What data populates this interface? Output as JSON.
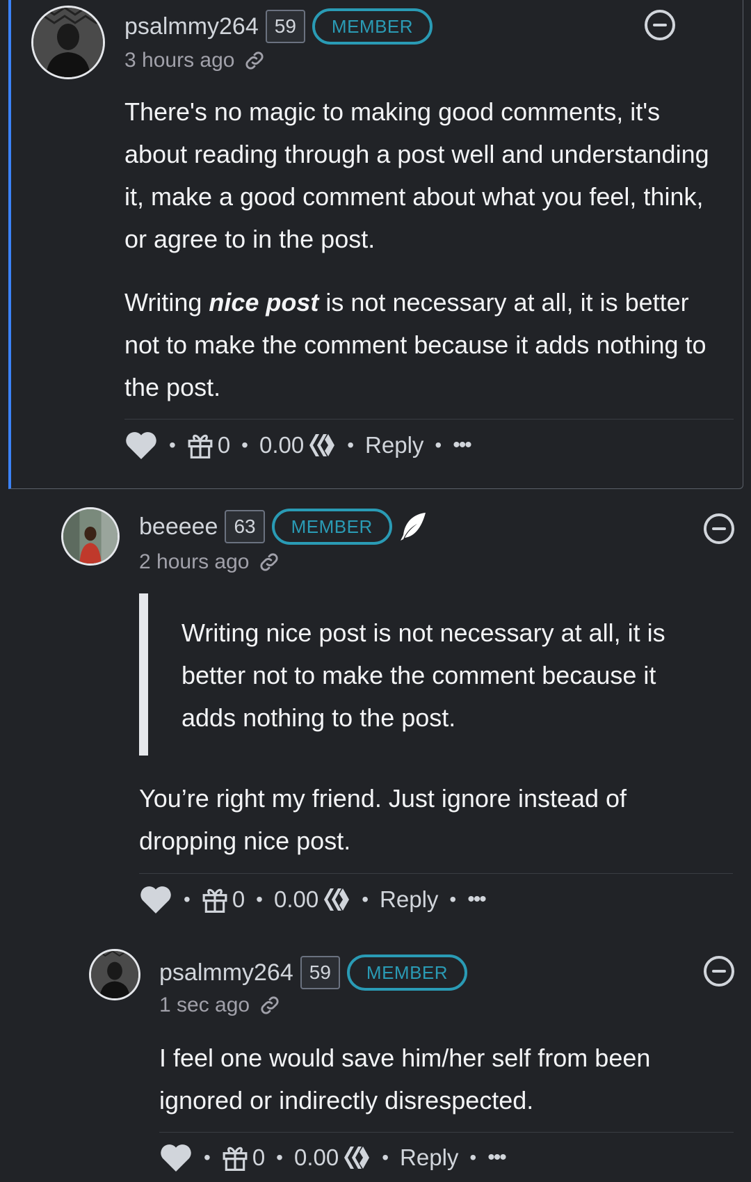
{
  "comments": [
    {
      "username": "psalmmy264",
      "reputation": "59",
      "badge": "MEMBER",
      "time": "3 hours ago",
      "paragraphs": [
        "There's no magic to making good comments, it's about reading through a post well and understanding it, make a good comment about what you feel, think, or agree to in the post."
      ],
      "para2_before": "Writing ",
      "para2_emph": "nice post",
      "para2_after": " is not necessary at all, it is better not to make the comment because it adds nothing to the post.",
      "gift_count": "0",
      "payout": "0.00",
      "reply_label": "Reply"
    },
    {
      "username": "beeeee",
      "reputation": "63",
      "badge": "MEMBER",
      "time": "2 hours ago",
      "quote": "Writing nice post is not necessary at all, it is better not to make the comment because it adds nothing to the post.",
      "text": "You’re right my friend. Just ignore instead of dropping nice post.",
      "gift_count": "0",
      "payout": "0.00",
      "reply_label": "Reply"
    },
    {
      "username": "psalmmy264",
      "reputation": "59",
      "badge": "MEMBER",
      "time": "1 sec ago",
      "text": "I feel one would save him/her self from been ignored or indirectly disrespected.",
      "gift_count": "0",
      "payout": "0.00",
      "reply_label": "Reply"
    }
  ],
  "icons": {
    "link": "link-icon",
    "collapse": "minus-circle-icon",
    "heart": "heart-icon",
    "gift": "gift-icon",
    "hive": "hive-icon",
    "more": "more-icon",
    "feather": "feather-icon"
  },
  "colors": {
    "background": "#212327",
    "accent_badge": "#2a9bb5",
    "highlight_border": "#3b82f6"
  },
  "separators": {
    "dot": "•",
    "more": "•••"
  }
}
